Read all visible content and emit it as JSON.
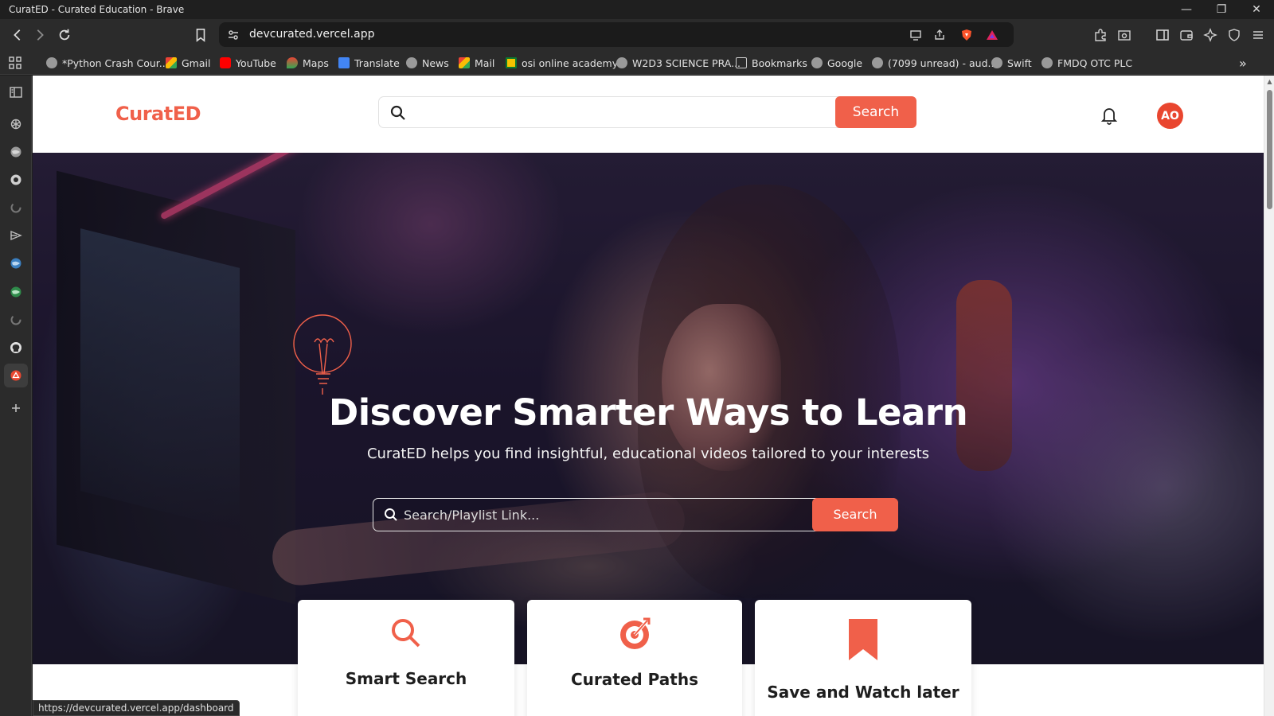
{
  "window": {
    "title": "CuratED - Curated Education - Brave",
    "controls": [
      "minimize",
      "restore",
      "close"
    ]
  },
  "toolbar": {
    "url": "devcurated.vercel.app",
    "icons": [
      "back-icon",
      "forward-icon",
      "reload-icon",
      "bookmark-icon",
      "site-info-icon",
      "cast-icon",
      "share-icon",
      "brave-shields-icon",
      "brave-rewards-icon",
      "extensions-icon",
      "screenshot-icon",
      "sidebar-icon",
      "wallet-icon",
      "leo-icon",
      "vpn-icon",
      "menu-icon"
    ]
  },
  "bookmarks": [
    {
      "label": "*Python Crash Cour...",
      "icon": "globe"
    },
    {
      "label": "Gmail",
      "icon": "gmail"
    },
    {
      "label": "YouTube",
      "icon": "yt"
    },
    {
      "label": "Maps",
      "icon": "maps"
    },
    {
      "label": "Translate",
      "icon": "translate"
    },
    {
      "label": "News",
      "icon": "globe"
    },
    {
      "label": "Mail",
      "icon": "gmail"
    },
    {
      "label": "osi online academy",
      "icon": "osi"
    },
    {
      "label": "W2D3 SCIENCE PRA...",
      "icon": "globe"
    },
    {
      "label": "Bookmarks",
      "icon": "folder"
    },
    {
      "label": "Google",
      "icon": "globe"
    },
    {
      "label": "(7099 unread) - aud...",
      "icon": "globe"
    },
    {
      "label": "Swift",
      "icon": "globe"
    },
    {
      "label": "FMDQ OTC PLC",
      "icon": "globe"
    }
  ],
  "bookmarks_more": "»",
  "sidebar_icons": [
    "sidebar-toggle-icon",
    "openai-icon",
    "globe-icon",
    "github-icon",
    "loading-icon",
    "play-icon",
    "globe-icon",
    "green-globe-icon",
    "loading-icon",
    "github-icon",
    "app-icon",
    "add-icon"
  ],
  "site": {
    "logo": "CuratED",
    "header_search_button": "Search",
    "avatar_initials": "AO",
    "hero_title": "Discover Smarter Ways to Learn",
    "hero_subtitle": "CuratED helps you find insightful, educational videos tailored to your interests",
    "hero_search_placeholder": "Search/Playlist Link...",
    "hero_search_button": "Search",
    "accent_color": "#f0604a",
    "cards": [
      {
        "title": "Smart Search",
        "icon": "search-icon"
      },
      {
        "title": "Curated Paths",
        "icon": "target-icon"
      },
      {
        "title": "Save and Watch later",
        "icon": "bookmark-icon"
      }
    ]
  },
  "status_url": "https://devcurated.vercel.app/dashboard"
}
